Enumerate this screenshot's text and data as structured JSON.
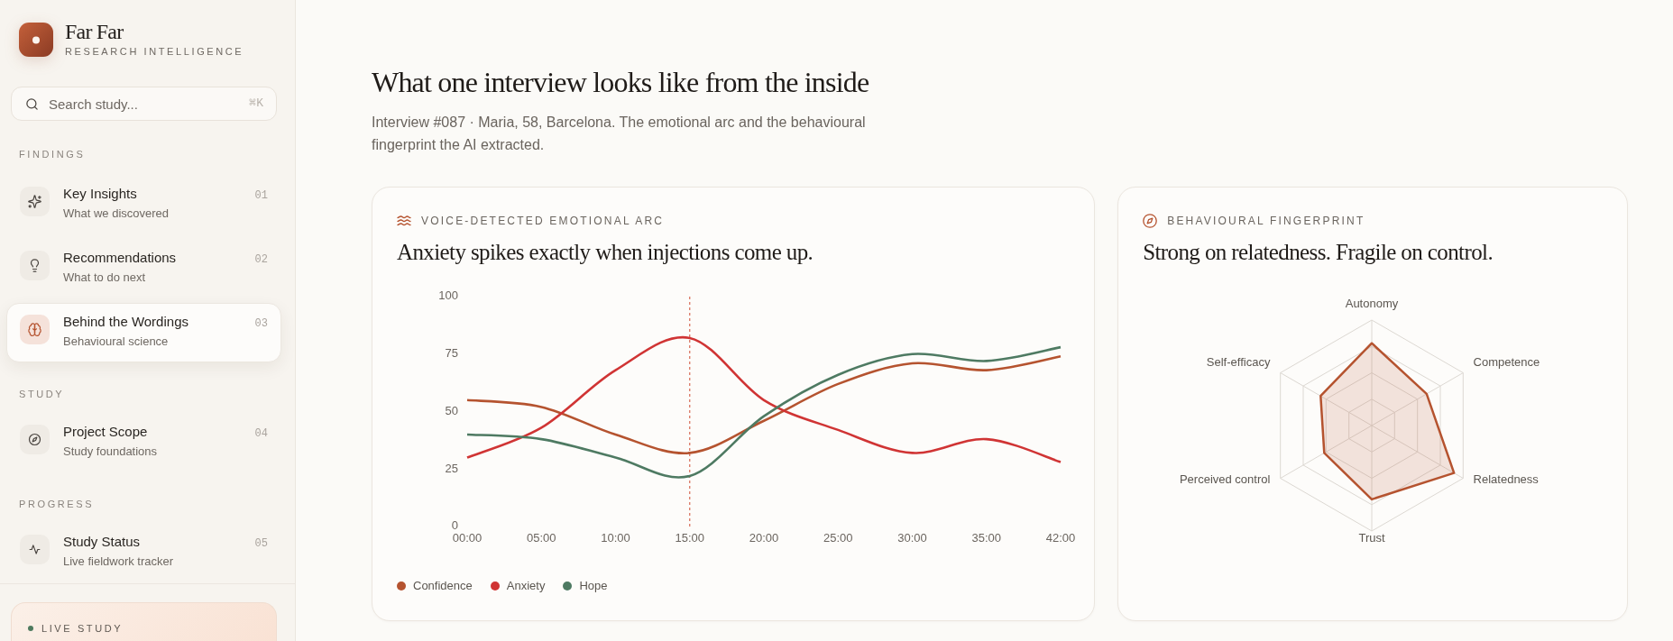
{
  "sidebar": {
    "brand": {
      "name": "Far Far",
      "tagline": "RESEARCH INTELLIGENCE"
    },
    "search": {
      "placeholder": "Search study...",
      "shortcut": "⌘K"
    },
    "sections": [
      {
        "label": "FINDINGS",
        "items": [
          {
            "title": "Key Insights",
            "subtitle": "What we discovered",
            "number": "01",
            "selected": false
          },
          {
            "title": "Recommendations",
            "subtitle": "What to do next",
            "number": "02",
            "selected": false
          },
          {
            "title": "Behind the Wordings",
            "subtitle": "Behavioural science",
            "number": "03",
            "selected": true
          }
        ]
      },
      {
        "label": "STUDY",
        "items": [
          {
            "title": "Project Scope",
            "subtitle": "Study foundations",
            "number": "04",
            "selected": false
          }
        ]
      },
      {
        "label": "PROGRESS",
        "items": [
          {
            "title": "Study Status",
            "subtitle": "Live fieldwork tracker",
            "number": "05",
            "selected": false
          }
        ]
      }
    ],
    "live_study": {
      "label": "LIVE STUDY"
    }
  },
  "main": {
    "title": "What one interview looks like from the inside",
    "subtitle": "Interview #087 · Maria, 58, Barcelona. The emotional arc and the behavioural fingerprint the AI extracted.",
    "cards": [
      {
        "kind": "line",
        "eyebrow": "VOICE-DETECTED EMOTIONAL ARC",
        "title": "Anxiety spikes exactly when injections come up.",
        "chart_data": {
          "type": "line",
          "categories": [
            "00:00",
            "05:00",
            "10:00",
            "15:00",
            "20:00",
            "25:00",
            "30:00",
            "35:00",
            "42:00"
          ],
          "series": [
            {
              "name": "Confidence",
              "color": "#b5532f",
              "values": [
                55,
                52,
                40,
                32,
                46,
                62,
                71,
                68,
                74
              ]
            },
            {
              "name": "Anxiety",
              "color": "#d03434",
              "values": [
                30,
                43,
                68,
                82,
                55,
                42,
                32,
                38,
                28
              ]
            },
            {
              "name": "Hope",
              "color": "#4e7a62",
              "values": [
                40,
                38,
                30,
                22,
                48,
                66,
                75,
                72,
                78
              ]
            }
          ],
          "ylim": [
            0,
            100
          ],
          "yticks": [
            0,
            25,
            50,
            75,
            100
          ],
          "ref_lines": [
            {
              "axis": "x",
              "value": "15:00"
            }
          ]
        }
      },
      {
        "kind": "radar",
        "eyebrow": "BEHAVIOURAL FINGERPRINT",
        "title": "Strong on relatedness. Fragile on control.",
        "axes": [
          "Autonomy",
          "Competence",
          "Relatedness",
          "Trust",
          "Perceived control",
          "Self-efficacy"
        ]
      }
    ]
  }
}
